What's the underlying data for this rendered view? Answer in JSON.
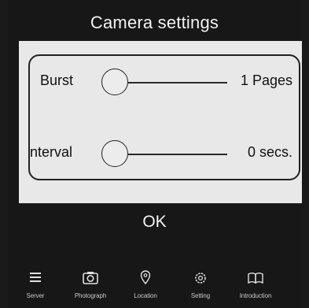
{
  "title": "Camera settings",
  "settings": {
    "burst": {
      "label": "Burst",
      "value": "1 Pages"
    },
    "interval": {
      "label": "nterval",
      "value": "0 secs."
    }
  },
  "ok_label": "OK",
  "nav": [
    {
      "label": "Server",
      "icon": "menu-icon"
    },
    {
      "label": "Photograph",
      "icon": "camera-icon"
    },
    {
      "label": "Location",
      "icon": "location-pin-icon"
    },
    {
      "label": "Setting",
      "icon": "gear-icon"
    },
    {
      "label": "Introduction",
      "icon": "book-icon"
    }
  ]
}
